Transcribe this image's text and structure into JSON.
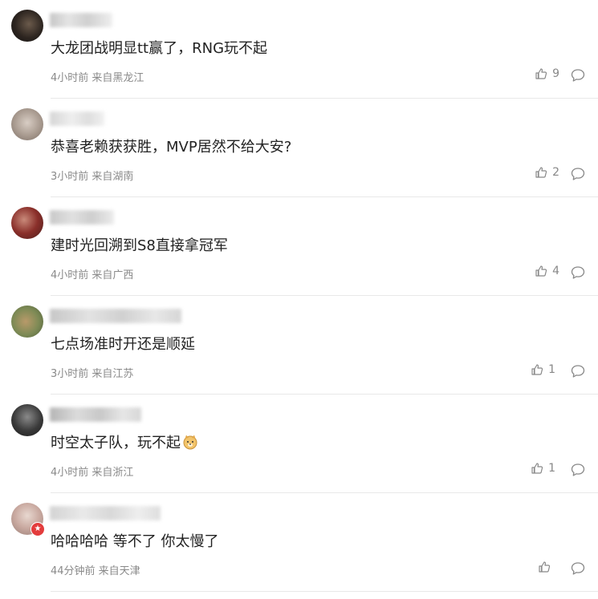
{
  "comments": [
    {
      "text": "大龙团战明显tt赢了，RNG玩不起",
      "meta": "4小时前 来自黑龙江",
      "likes": "9"
    },
    {
      "text": "恭喜老赖获获胜，MVP居然不给大安?",
      "meta": "3小时前 来自湖南",
      "likes": "2"
    },
    {
      "text": "建时光回溯到S8直接拿冠军",
      "meta": "4小时前 来自广西",
      "likes": "4"
    },
    {
      "text": "七点场准时开还是顺延",
      "meta": "3小时前 来自江苏",
      "likes": "1"
    },
    {
      "text": "时空太子队，玩不起",
      "meta": "4小时前 来自浙江",
      "likes": "1"
    },
    {
      "text": "哈哈哈哈 等不了 你太慢了",
      "meta": "44分钟前 来自天津",
      "likes": ""
    }
  ],
  "colors": {
    "meta": "#8a8a8a",
    "divider": "#e8e8e8",
    "badge": "#e33c3c"
  },
  "icons": {
    "like": "thumbs-up-icon",
    "reply": "comment-bubble-icon",
    "emoji": "doge-emoji-icon",
    "badge": "star-badge-icon"
  }
}
